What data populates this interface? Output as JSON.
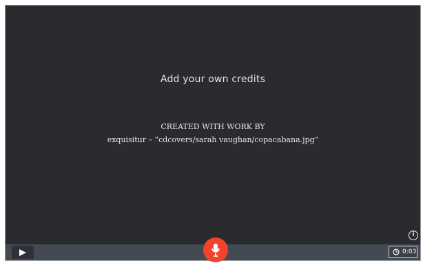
{
  "stage": {
    "title": "Add your own credits",
    "created_with": "CREATED WITH WORK BY",
    "attribution": "exquisitur – “cdcovers/sarah vaughan/copacabana.jpg”"
  },
  "controls": {
    "play_icon": "play-icon",
    "mic_icon": "microphone-icon",
    "info_icon": "info-icon",
    "timer_icon": "clock-icon",
    "timer_value": "0:03"
  },
  "colors": {
    "stage_background": "#2a2b2e",
    "control_bar": "#434a53",
    "record_button": "#f2432c"
  }
}
